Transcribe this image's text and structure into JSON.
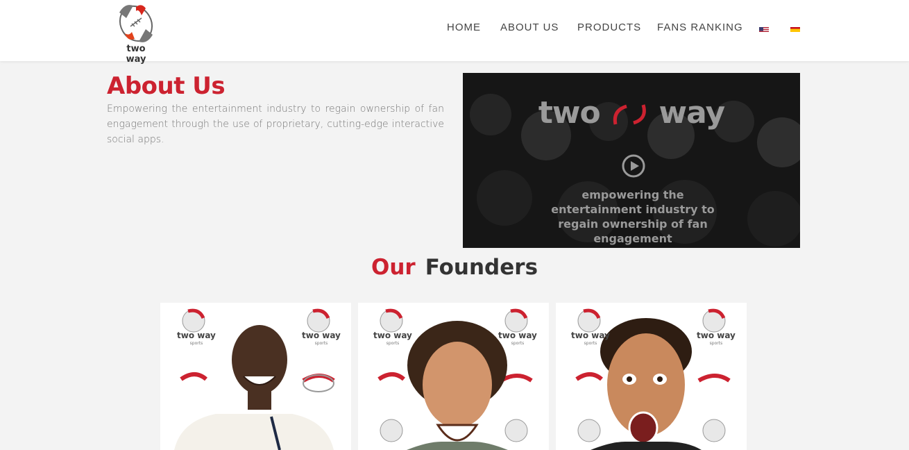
{
  "header": {
    "logo_text": "two way",
    "nav": [
      {
        "label": "HOME"
      },
      {
        "label": "ABOUT US"
      },
      {
        "label": "PRODUCTS"
      },
      {
        "label": "FANS RANKING"
      }
    ],
    "flags": [
      "us-flag-icon",
      "es-flag-icon"
    ]
  },
  "about": {
    "title": "About Us",
    "text": "Empowering the entertainment industry to regain ownership of fan engagement through the use of proprietary, cutting-edge interactive social apps."
  },
  "video": {
    "logo_left": "two",
    "logo_right": "way",
    "caption": "empowering the entertainment industry to regain ownership of fan engagement",
    "icon": "play-icon"
  },
  "founders": {
    "title_accent": "Our",
    "title_rest": "Founders",
    "brand_text": "two way",
    "brand_sub": "sports"
  },
  "colors": {
    "accent": "#cc2230",
    "nav_text": "#444444",
    "background": "#f3f3f3"
  }
}
